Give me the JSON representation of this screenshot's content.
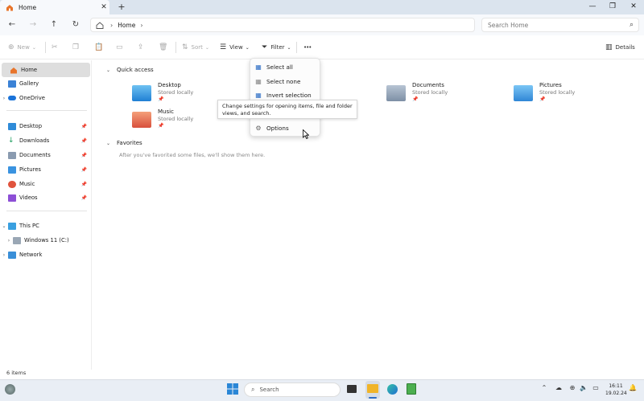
{
  "window": {
    "tab_title": "Home",
    "new_tab": "+",
    "minimize": "—",
    "maximize": "❐",
    "close": "✕"
  },
  "address": {
    "crumb": "Home",
    "search_placeholder": "Search Home"
  },
  "toolbar": {
    "new_label": "New",
    "sort_label": "Sort",
    "view_label": "View",
    "filter_label": "Filter",
    "more_label": "•••",
    "details_label": "Details"
  },
  "sidebar": {
    "items": [
      {
        "label": "Home"
      },
      {
        "label": "Gallery"
      },
      {
        "label": "OneDrive"
      },
      {
        "label": "Desktop"
      },
      {
        "label": "Downloads"
      },
      {
        "label": "Documents"
      },
      {
        "label": "Pictures"
      },
      {
        "label": "Music"
      },
      {
        "label": "Videos"
      },
      {
        "label": "This PC"
      },
      {
        "label": "Windows 11 (C:)"
      },
      {
        "label": "Network"
      }
    ]
  },
  "content": {
    "quick_access_title": "Quick access",
    "favorites_title": "Favorites",
    "favorites_empty": "After you've favorited some files, we'll show them here.",
    "tiles": [
      {
        "name": "Desktop",
        "sub": "Stored locally"
      },
      {
        "name": "Music",
        "sub": "Stored locally"
      },
      {
        "name": "Documents",
        "sub": "Stored locally"
      },
      {
        "name": "Pictures",
        "sub": "Stored locally"
      }
    ]
  },
  "menu": {
    "items": [
      {
        "label": "Select all"
      },
      {
        "label": "Select none"
      },
      {
        "label": "Invert selection"
      },
      {
        "label": "Options"
      }
    ],
    "tooltip": "Change settings for opening items, file and folder views, and search."
  },
  "status": {
    "count": "6 items"
  },
  "taskbar": {
    "search_label": "Search",
    "time": "16:11",
    "date": "19.02.24"
  },
  "colors": {
    "accent": "#2b6cc4",
    "folder_blue": "#2f8bd8",
    "titlebar_bg": "#dbe4ee",
    "taskbar_bg": "#e9eef5"
  }
}
